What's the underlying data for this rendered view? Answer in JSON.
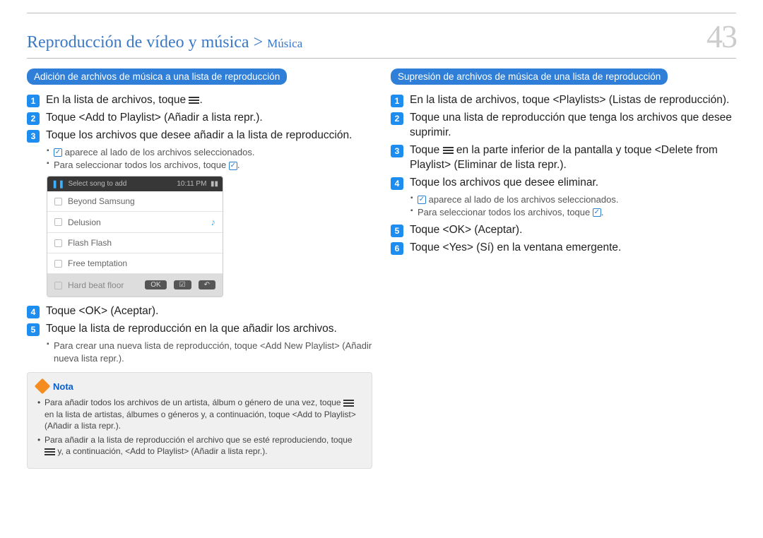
{
  "header": {
    "breadcrumb_main": "Reproducción de vídeo y música > ",
    "breadcrumb_sub": "Música",
    "page_number": "43"
  },
  "left": {
    "pill": "Adición de archivos de música a una lista de reproducción",
    "step1": "En la lista de archivos, toque ",
    "step2": "Toque <Add to Playlist> (Añadir a lista repr.).",
    "step3": "Toque los archivos que desee añadir a la lista de reproducción.",
    "step3_b1a": " aparece al lado de los archivos seleccionados.",
    "step3_b2a": "Para seleccionar todos los archivos, toque ",
    "step4": "Toque <OK> (Aceptar).",
    "step5": "Toque la lista de reproducción en la que añadir los archivos.",
    "step5_b1": "Para crear una nueva lista de reproducción, toque <Add New Playlist> (Añadir nueva lista repr.)."
  },
  "device": {
    "title": "Select song to add",
    "time": "10:11 PM",
    "songs": [
      "Beyond Samsung",
      "Delusion",
      "Flash Flash",
      "Free temptation",
      "Hard beat floor"
    ],
    "ok": "OK"
  },
  "note": {
    "label": "Nota",
    "n1a": "Para añadir todos los archivos de un artista, álbum o género de una vez, toque ",
    "n1b": " en la lista de artistas, álbumes o géneros y, a continuación, toque <Add to Playlist> (Añadir a lista repr.).",
    "n2a": "Para añadir a la lista de reproducción el archivo que se esté reproduciendo, toque ",
    "n2b": " y, a continuación, <Add to Playlist> (Añadir a lista repr.)."
  },
  "right": {
    "pill": "Supresión de archivos de música de una lista de reproducción",
    "step1": "En la lista de archivos, toque <Playlists> (Listas de reproducción).",
    "step2": "Toque una lista de reproducción que tenga los archivos que desee suprimir.",
    "step3a": "Toque ",
    "step3b": " en la parte inferior de la pantalla y toque <Delete from Playlist> (Eliminar de lista repr.).",
    "step4": "Toque los archivos que desee eliminar.",
    "step4_b1a": " aparece al lado de los archivos seleccionados.",
    "step4_b2a": "Para seleccionar todos los archivos, toque ",
    "step5": "Toque <OK> (Aceptar).",
    "step6": "Toque <Yes> (Sí) en la ventana emergente."
  }
}
